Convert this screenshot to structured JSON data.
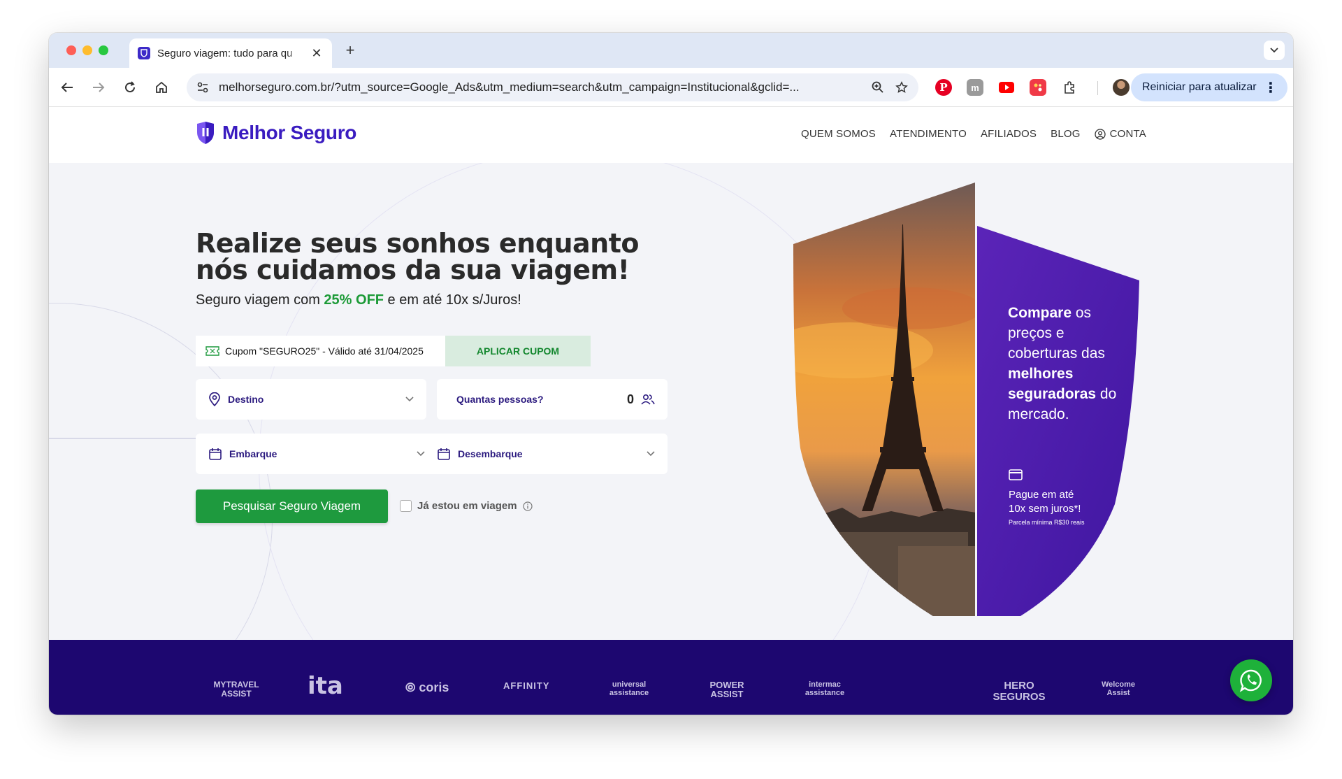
{
  "browser": {
    "tab_title": "Seguro viagem: tudo para qu",
    "url": "melhorseguro.com.br/?utm_source=Google_Ads&utm_medium=search&utm_campaign=Institucional&gclid=...",
    "update_button": "Reiniciar para atualizar"
  },
  "site": {
    "logo_text": "Melhor Seguro",
    "nav": [
      "QUEM SOMOS",
      "ATENDIMENTO",
      "AFILIADOS",
      "BLOG",
      "CONTA"
    ]
  },
  "hero": {
    "title": "Realize seus sonhos enquanto nós cuidamos da sua viagem!",
    "subtitle_pre": "Seguro viagem com ",
    "subtitle_off": "25% OFF",
    "subtitle_post": " e em até 10x s/Juros!"
  },
  "coupon": {
    "text": "Cupom \"SEGURO25\" - Válido até 31/04/2025",
    "button": "APLICAR CUPOM"
  },
  "form": {
    "destino": "Destino",
    "pessoas_label": "Quantas pessoas?",
    "pessoas_count": "0",
    "embarque": "Embarque",
    "desembarque": "Desembarque",
    "search_button": "Pesquisar Seguro Viagem",
    "traveling_label": "Já estou em viagem"
  },
  "promo": {
    "compare": "Compare",
    "text1": " os preços e coberturas das ",
    "bold2": "melhores seguradoras",
    "text2": " do mercado.",
    "pay_line1": "Pague em até",
    "pay_line2": "10x sem juros*!",
    "pay_small": "Parcela mínima R$30 reais"
  },
  "partners": [
    "MYTRAVEL ASSIST",
    "ita",
    "coris",
    "AFFINITY",
    "universal assistance",
    "POWER ASSIST",
    "intermac assistance",
    "HERO SEGUROS",
    "Welcome Assist"
  ],
  "colors": {
    "brand_purple": "#3a1cc0",
    "green": "#1e9a3e",
    "partners_bg": "#1d0770"
  }
}
